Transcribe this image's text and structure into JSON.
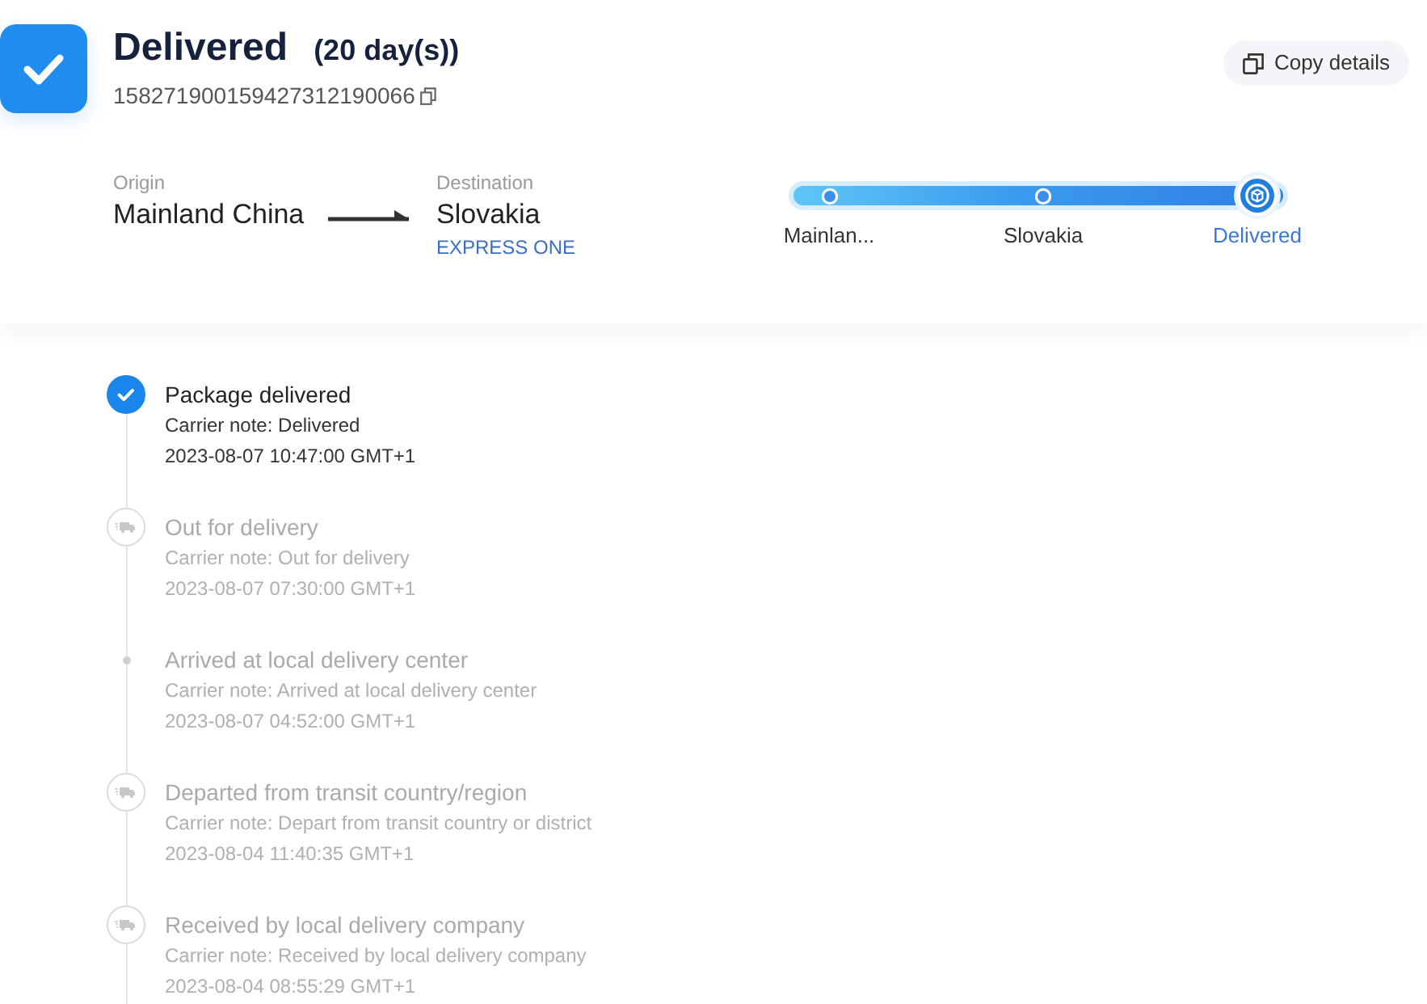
{
  "header": {
    "status": "Delivered",
    "duration": "(20 day(s))",
    "tracking_number": "158271900159427312190066",
    "copy_button": "Copy details"
  },
  "route": {
    "origin_label": "Origin",
    "origin": "Mainland China",
    "destination_label": "Destination",
    "destination": "Slovakia",
    "carrier": "EXPRESS ONE"
  },
  "progress": {
    "level": 1,
    "stops": [
      {
        "label": "Mainlan...",
        "selected": false
      },
      {
        "label": "Slovakia",
        "selected": false
      },
      {
        "label": "Delivered",
        "selected": true
      }
    ]
  },
  "events": [
    {
      "kind": "delivered",
      "current": true,
      "title": "Package delivered",
      "note": "Carrier note: Delivered",
      "time": "2023-08-07 10:47:00 GMT+1"
    },
    {
      "kind": "transit",
      "current": false,
      "title": "Out for delivery",
      "note": "Carrier note: Out for delivery",
      "time": "2023-08-07 07:30:00 GMT+1"
    },
    {
      "kind": "dot",
      "current": false,
      "title": "Arrived at local delivery center",
      "note": "Carrier note: Arrived at local delivery center",
      "time": "2023-08-07 04:52:00 GMT+1"
    },
    {
      "kind": "transit",
      "current": false,
      "title": "Departed from transit country/region",
      "note": "Carrier note: Depart from transit country or district",
      "time": "2023-08-04 11:40:35 GMT+1"
    },
    {
      "kind": "transit",
      "current": false,
      "title": "Received by local delivery company",
      "note": "Carrier note: Received by local delivery company",
      "time": "2023-08-04 08:55:29 GMT+1"
    }
  ]
}
